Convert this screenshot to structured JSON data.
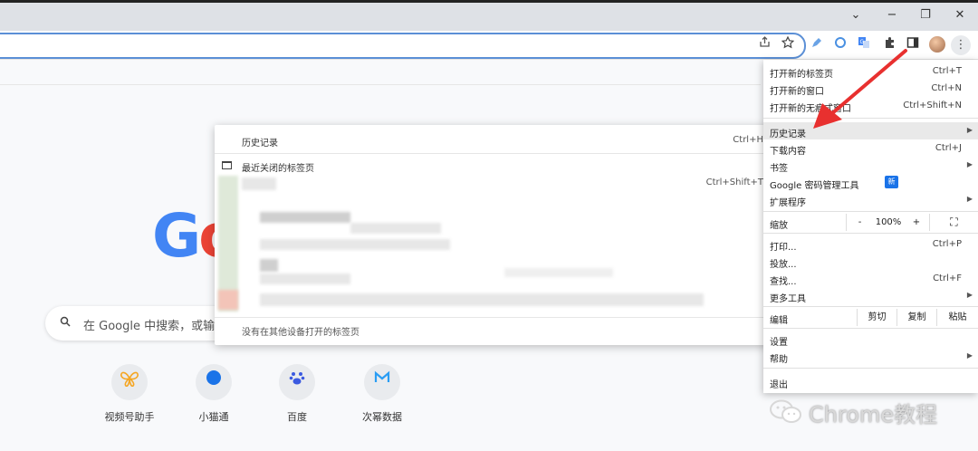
{
  "window": {
    "minimize_glyph": "−",
    "restore_glyph": "❐",
    "close_glyph": "✕",
    "collapse_glyph": "⌄"
  },
  "toolbar": {
    "icons": [
      "share-icon",
      "star-icon",
      "extension-pen-icon",
      "extension-ring-icon",
      "translate-icon",
      "puzzle-icon",
      "side-panel-icon"
    ],
    "menu_glyph": "⋮"
  },
  "newtab": {
    "search_placeholder": "在 Google 中搜索，或输",
    "shortcuts": [
      {
        "label": "视频号助手",
        "icon": "butterfly-icon",
        "color": "#f5a623"
      },
      {
        "label": "小猫通",
        "icon": "moon-icon",
        "color": "#1a73e8"
      },
      {
        "label": "百度",
        "icon": "paw-icon",
        "color": "#3b5ae0"
      },
      {
        "label": "次幂数据",
        "icon": "chart-m-icon",
        "color": "#2a9df4"
      }
    ]
  },
  "history_submenu": {
    "title": "历史记录",
    "title_shortcut": "Ctrl+H",
    "recently_closed": "最近关闭的标签页",
    "reopen_shortcut": "Ctrl+Shift+T",
    "no_other_devices": "没有在其他设备打开的标签页"
  },
  "chrome_menu": {
    "items": {
      "new_tab": {
        "label": "打开新的标签页",
        "key": "Ctrl+T"
      },
      "new_window": {
        "label": "打开新的窗口",
        "key": "Ctrl+N"
      },
      "incognito": {
        "label": "打开新的无痕式窗口",
        "key": "Ctrl+Shift+N"
      },
      "history": {
        "label": "历史记录"
      },
      "downloads": {
        "label": "下载内容",
        "key": "Ctrl+J"
      },
      "bookmarks": {
        "label": "书签"
      },
      "passwords": {
        "label": "Google 密码管理工具",
        "badge": "新"
      },
      "extensions": {
        "label": "扩展程序"
      },
      "zoom": {
        "label": "缩放",
        "minus": "-",
        "value": "100%",
        "plus": "+",
        "fullscreen": "⛶"
      },
      "print": {
        "label": "打印...",
        "key": "Ctrl+P"
      },
      "cast": {
        "label": "投放..."
      },
      "find": {
        "label": "查找...",
        "key": "Ctrl+F"
      },
      "more_tools": {
        "label": "更多工具"
      },
      "edit": {
        "label": "编辑",
        "cut": "剪切",
        "copy": "复制",
        "paste": "粘贴"
      },
      "settings": {
        "label": "设置"
      },
      "help": {
        "label": "帮助"
      },
      "exit": {
        "label": "退出"
      }
    }
  },
  "watermark": {
    "text": "Chrome教程"
  },
  "colors": {
    "accent": "#1a73e8",
    "arrow": "#e8302f",
    "highlight": "#e9e9e9"
  }
}
